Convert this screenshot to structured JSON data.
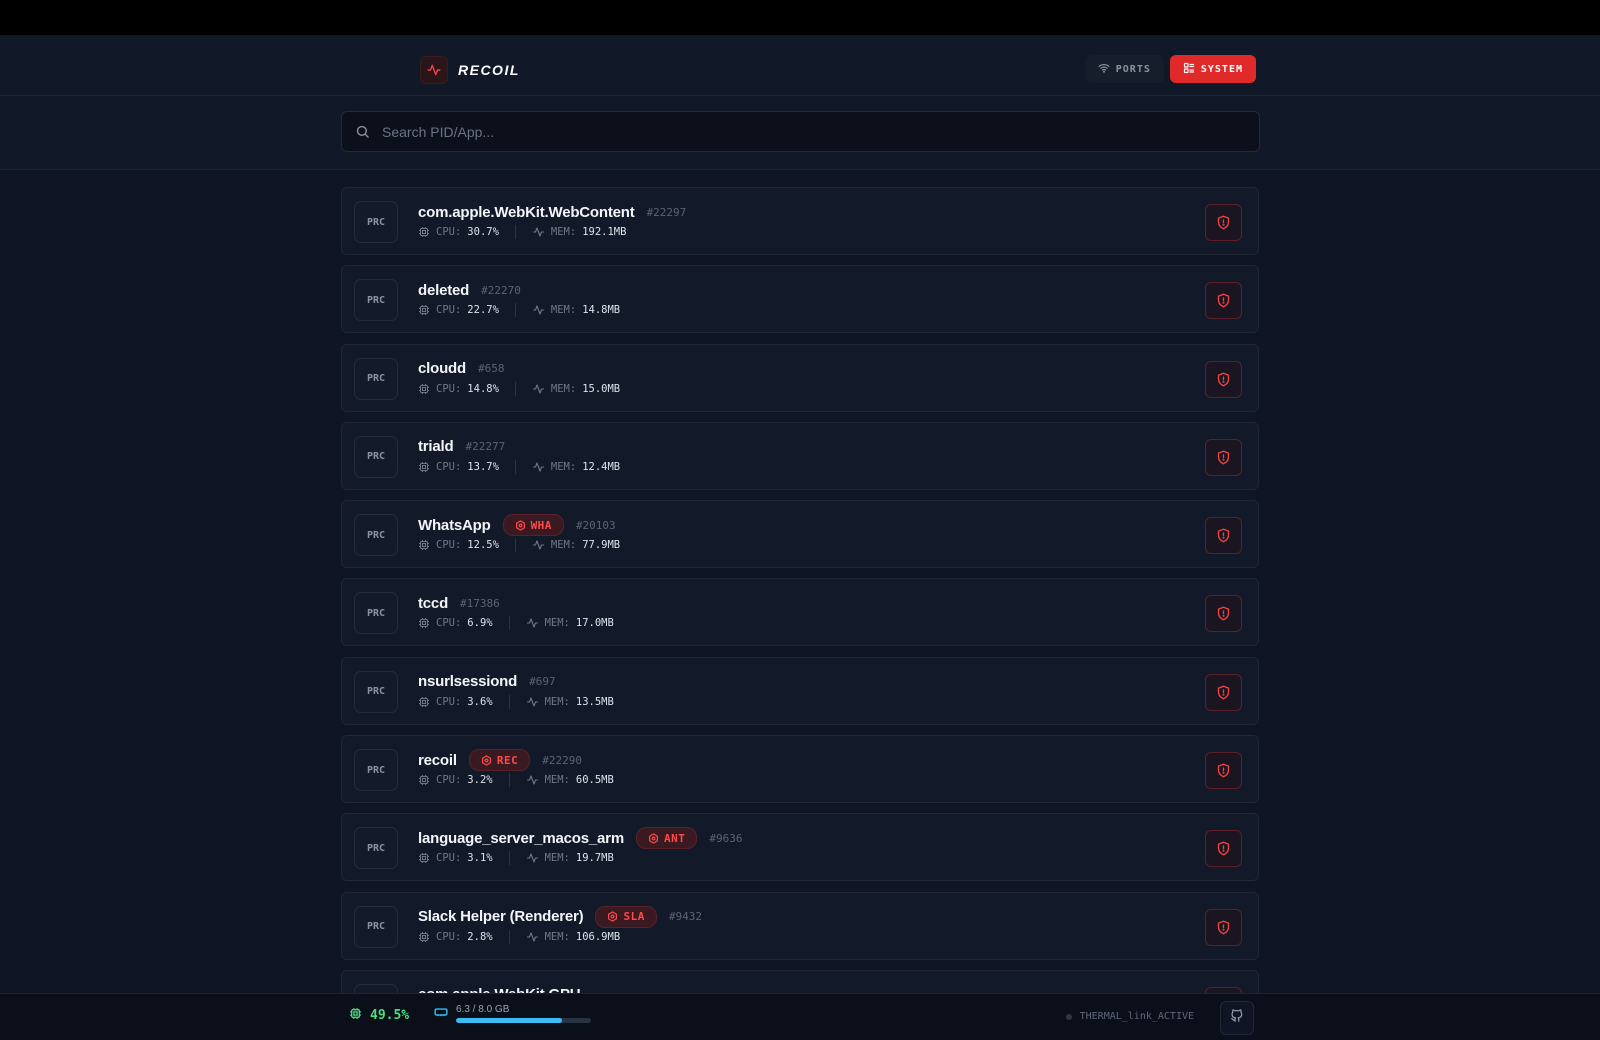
{
  "app": {
    "name": "RECOIL"
  },
  "nav": {
    "ports_label": "PORTS",
    "system_label": "SYSTEM",
    "active": "SYSTEM"
  },
  "search": {
    "placeholder": "Search PID/App...",
    "value": ""
  },
  "list": {
    "prc_label": "PRC",
    "cpu_label": "CPU:",
    "mem_label": "MEM:",
    "processes": [
      {
        "name": "com.apple.WebKit.WebContent",
        "tag": "",
        "pid": "#22297",
        "cpu": "30.7%",
        "mem": "192.1MB"
      },
      {
        "name": "deleted",
        "tag": "",
        "pid": "#22270",
        "cpu": "22.7%",
        "mem": "14.8MB"
      },
      {
        "name": "cloudd",
        "tag": "",
        "pid": "#658",
        "cpu": "14.8%",
        "mem": "15.0MB"
      },
      {
        "name": "triald",
        "tag": "",
        "pid": "#22277",
        "cpu": "13.7%",
        "mem": "12.4MB"
      },
      {
        "name": "WhatsApp",
        "tag": "WHA",
        "pid": "#20103",
        "cpu": "12.5%",
        "mem": "77.9MB"
      },
      {
        "name": "tccd",
        "tag": "",
        "pid": "#17386",
        "cpu": "6.9%",
        "mem": "17.0MB"
      },
      {
        "name": "nsurlsessiond",
        "tag": "",
        "pid": "#697",
        "cpu": "3.6%",
        "mem": "13.5MB"
      },
      {
        "name": "recoil",
        "tag": "REC",
        "pid": "#22290",
        "cpu": "3.2%",
        "mem": "60.5MB"
      },
      {
        "name": "language_server_macos_arm",
        "tag": "ANT",
        "pid": "#9636",
        "cpu": "3.1%",
        "mem": "19.7MB"
      },
      {
        "name": "Slack Helper (Renderer)",
        "tag": "SLA",
        "pid": "#9432",
        "cpu": "2.8%",
        "mem": "106.9MB"
      },
      {
        "name": "com.apple.WebKit.GPU",
        "tag": "",
        "pid": "",
        "cpu": "",
        "mem": ""
      }
    ]
  },
  "footer": {
    "cpu_total": "49.5%",
    "mem_text": "6.3 / 8.0 GB",
    "mem_fraction": 0.7875,
    "status": "THERMAL_link_ACTIVE"
  },
  "colors": {
    "accent": "#e02a2a",
    "cpu_ok": "#4ade80",
    "mem_bar": "#38bdf8",
    "background": "#0f1524"
  },
  "icons": {
    "brand": "activity-icon",
    "ports": "wifi-icon",
    "system": "list-icon",
    "search": "search-icon",
    "cpu": "chip-icon",
    "mem": "activity-icon",
    "tag": "hexagon-icon",
    "kill": "shield-alert-icon",
    "footer_mem": "memory-icon",
    "footer_btn": "github-icon"
  }
}
